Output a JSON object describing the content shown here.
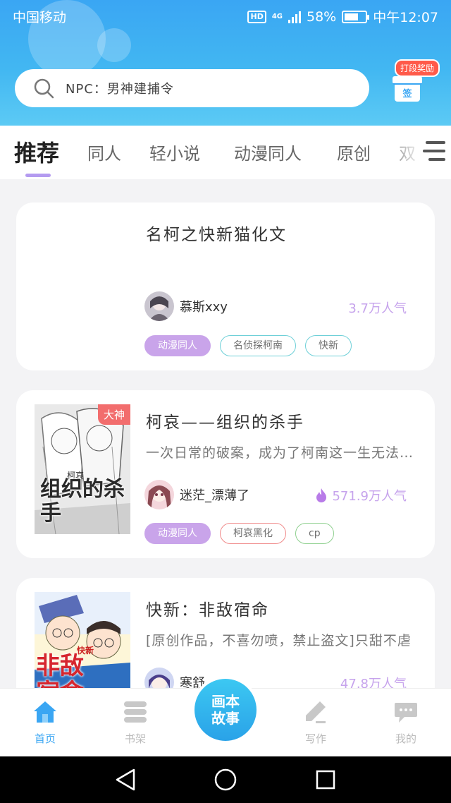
{
  "status_bar": {
    "carrier": "中国移动",
    "network": "4G",
    "battery": "58%",
    "time": "中午12:07",
    "hd": "HD"
  },
  "search": {
    "placeholder": "NPC：男神建捕令"
  },
  "checkin": {
    "badge": "打段奖励",
    "label": "签"
  },
  "tabs": [
    {
      "label": "推荐",
      "active": true
    },
    {
      "label": "同人"
    },
    {
      "label": "轻小说"
    },
    {
      "label": "动漫同人"
    },
    {
      "label": "原创"
    },
    {
      "label": "双"
    }
  ],
  "feed": [
    {
      "title": "名柯之快新猫化文",
      "author": "慕斯xxy",
      "popularity": "3.7万人气",
      "tags": [
        {
          "label": "动漫同人",
          "style": "filled",
          "color": "#c9a4ea"
        },
        {
          "label": "名侦探柯南",
          "style": "outline",
          "color": "#6fd0d8"
        },
        {
          "label": "快新",
          "style": "outline",
          "color": "#6fd0d8"
        }
      ]
    },
    {
      "title": "柯哀——组织的杀手",
      "description": "一次日常的破案，成为了柯南这一生无法忘记的",
      "author": "迷茫_漂薄了",
      "popularity": "571.9万人气",
      "cover_badge": "大神",
      "cover_text": "组织的杀手",
      "cover_small": "柯哀",
      "tags": [
        {
          "label": "动漫同人",
          "style": "filled",
          "color": "#c9a4ea"
        },
        {
          "label": "柯哀黑化",
          "style": "outline",
          "color": "#f08a8a"
        },
        {
          "label": "cp",
          "style": "outline",
          "color": "#8fd08f"
        }
      ]
    },
    {
      "title": "快新：非敌宿命",
      "description": "[原创作品，不喜勿喷，禁止盗文]只甜不虐",
      "author": "寒舒",
      "popularity": "47.8万人气",
      "cover_text": "非敌宿命",
      "cover_small": "快新"
    }
  ],
  "bottom_nav": [
    {
      "label": "首页",
      "active": true
    },
    {
      "label": "书架"
    },
    {
      "label": "画本故事"
    },
    {
      "label": "写作"
    },
    {
      "label": "我的"
    }
  ],
  "story_button": {
    "line1": "画本",
    "line2": "故事"
  },
  "colors": {
    "accent": "#3aa6f3",
    "tag_purple": "#c9a4ea",
    "popularity": "#c6a3ec"
  }
}
